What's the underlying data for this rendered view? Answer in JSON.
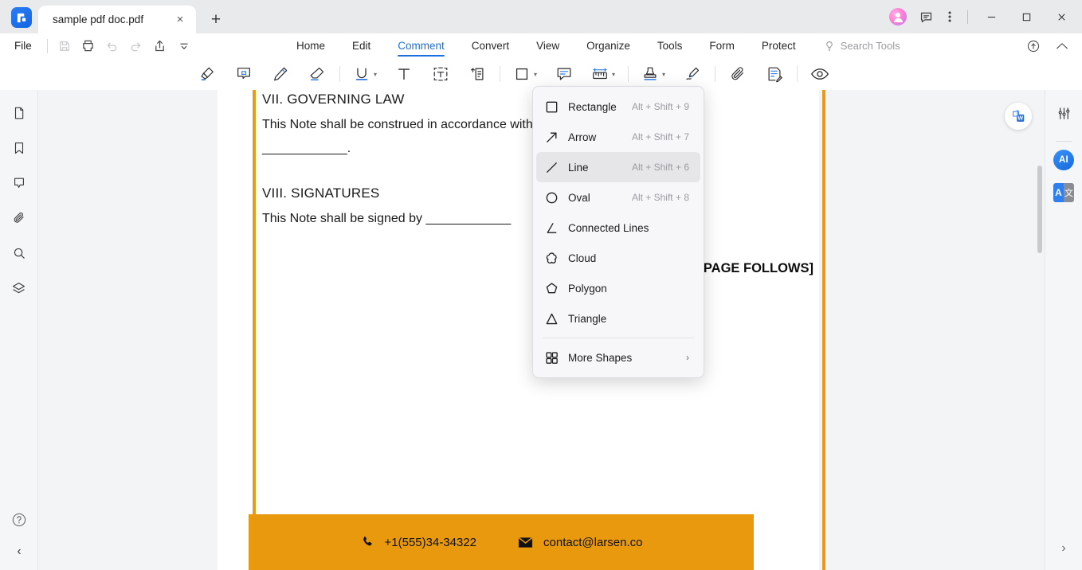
{
  "titlebar": {
    "tab_label": "sample pdf doc.pdf",
    "close_tab": "×",
    "new_tab": "+",
    "minimize": "—",
    "maximize": "□",
    "close": "✕"
  },
  "menubar": {
    "file": "File",
    "tabs": [
      {
        "label": "Home",
        "active": false
      },
      {
        "label": "Edit",
        "active": false
      },
      {
        "label": "Comment",
        "active": true
      },
      {
        "label": "Convert",
        "active": false
      },
      {
        "label": "View",
        "active": false
      },
      {
        "label": "Organize",
        "active": false
      },
      {
        "label": "Tools",
        "active": false
      },
      {
        "label": "Form",
        "active": false
      },
      {
        "label": "Protect",
        "active": false
      }
    ],
    "search_tools": "Search Tools"
  },
  "toolbar": {
    "items": [
      "highlight-tool",
      "area-highlight-tool",
      "pencil-tool",
      "eraser-tool",
      "underline-tool",
      "text-tool",
      "text-box-tool",
      "text-callout-tool",
      "shapes-tool",
      "note-tool",
      "measure-tool",
      "stamp-tool",
      "signature-tool",
      "attachment-tool",
      "summary-tool",
      "view-comments-tool"
    ]
  },
  "shapes_menu": {
    "items": [
      {
        "label": "Rectangle",
        "shortcut": "Alt + Shift + 9",
        "icon": "rectangle-icon",
        "highlighted": false
      },
      {
        "label": "Arrow",
        "shortcut": "Alt + Shift + 7",
        "icon": "arrow-icon",
        "highlighted": false
      },
      {
        "label": "Line",
        "shortcut": "Alt + Shift + 6",
        "icon": "line-icon",
        "highlighted": true
      },
      {
        "label": "Oval",
        "shortcut": "Alt + Shift + 8",
        "icon": "oval-icon",
        "highlighted": false
      },
      {
        "label": "Connected Lines",
        "shortcut": "",
        "icon": "connected-lines-icon",
        "highlighted": false
      },
      {
        "label": "Cloud",
        "shortcut": "",
        "icon": "cloud-icon",
        "highlighted": false
      },
      {
        "label": "Polygon",
        "shortcut": "",
        "icon": "polygon-icon",
        "highlighted": false
      },
      {
        "label": "Triangle",
        "shortcut": "",
        "icon": "triangle-icon",
        "highlighted": false
      }
    ],
    "more": {
      "label": "More Shapes",
      "arrow": "›",
      "icon": "grid-icon"
    }
  },
  "document": {
    "heading_7": "VII. GOVERNING LAW",
    "para_7": "This Note shall be construed in accordance with the laws of the State of",
    "blank_line": "____________.",
    "heading_8": "VIII. SIGNATURES",
    "para_8": "This Note shall be signed by ____________",
    "page_follows": "[SIGNATURE PAGE FOLLOWS]",
    "footer": {
      "phone": "+1(555)34-34322",
      "email": "contact@larsen.co",
      "phone_icon": "phone-icon",
      "email_icon": "envelope-icon",
      "bar_color": "#e8990d"
    },
    "border_color": "#e89c15",
    "convert_to_word": "convert-to-word-button"
  },
  "left_rail": {
    "items": [
      "page-thumbnails-icon",
      "bookmarks-icon",
      "comments-icon",
      "attachments-icon",
      "search-icon",
      "layers-icon"
    ],
    "help": "?",
    "collapse": "‹"
  },
  "right_rail": {
    "properties": "sliders-icon",
    "ai": "AI",
    "translate_left": "A",
    "translate_right": "文",
    "expand": "›"
  }
}
